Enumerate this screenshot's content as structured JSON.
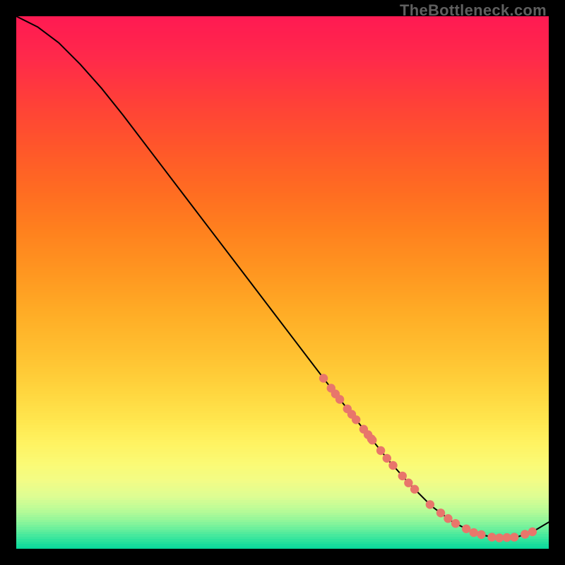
{
  "watermark": "TheBottleneck.com",
  "colors": {
    "black": "#000000",
    "curve": "#000000",
    "dot": "#e8766b",
    "watermark": "#5f5f5f"
  },
  "chart_data": {
    "type": "line",
    "title": "",
    "xlabel": "",
    "ylabel": "",
    "xlim": [
      0,
      100
    ],
    "ylim": [
      0,
      100
    ],
    "gradient_stops": [
      {
        "t": 0.0,
        "color": "#ff1a52"
      },
      {
        "t": 0.08,
        "color": "#ff2a4a"
      },
      {
        "t": 0.16,
        "color": "#ff4038"
      },
      {
        "t": 0.24,
        "color": "#ff552b"
      },
      {
        "t": 0.32,
        "color": "#ff6a22"
      },
      {
        "t": 0.4,
        "color": "#ff801e"
      },
      {
        "t": 0.48,
        "color": "#ff9620"
      },
      {
        "t": 0.56,
        "color": "#ffad26"
      },
      {
        "t": 0.64,
        "color": "#ffc231"
      },
      {
        "t": 0.7,
        "color": "#ffd43d"
      },
      {
        "t": 0.76,
        "color": "#ffe64e"
      },
      {
        "t": 0.8,
        "color": "#fff260"
      },
      {
        "t": 0.84,
        "color": "#fbfa74"
      },
      {
        "t": 0.875,
        "color": "#f2fc86"
      },
      {
        "t": 0.905,
        "color": "#dcfd93"
      },
      {
        "t": 0.93,
        "color": "#b8fb97"
      },
      {
        "t": 0.95,
        "color": "#90f69a"
      },
      {
        "t": 0.966,
        "color": "#66ef9c"
      },
      {
        "t": 0.98,
        "color": "#3fe79d"
      },
      {
        "t": 0.992,
        "color": "#20df9c"
      },
      {
        "t": 1.0,
        "color": "#0bd99b"
      }
    ],
    "series": [
      {
        "name": "curve",
        "x": [
          0,
          4,
          8,
          12,
          16,
          20,
          28,
          36,
          44,
          52,
          60,
          66,
          70,
          74,
          78,
          82,
          86,
          90,
          94,
          97,
          100
        ],
        "y": [
          100,
          98,
          95,
          91,
          86.5,
          81.5,
          71,
          60.5,
          50,
          39.5,
          29,
          21.5,
          16.5,
          12,
          8,
          5,
          3,
          2,
          2.2,
          3.2,
          5
        ]
      }
    ],
    "dot_clusters": [
      {
        "name": "upper-segment",
        "x_range": [
          58,
          67
        ],
        "count": 10
      },
      {
        "name": "mid-segment",
        "x_range": [
          67,
          75
        ],
        "count": 7
      },
      {
        "name": "floor-segment",
        "x_range": [
          78,
          97
        ],
        "count": 13
      }
    ]
  }
}
